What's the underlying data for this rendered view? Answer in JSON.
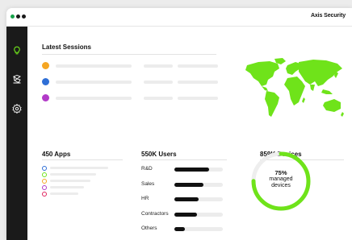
{
  "window": {
    "brand": "Axis Security",
    "traffic_light_colors": [
      "#16a34a",
      "#1a1a1a",
      "#1a1a1a"
    ]
  },
  "sidebar": {
    "items": [
      {
        "icon": "lightbulb-icon",
        "active": true
      },
      {
        "icon": "network-icon",
        "active": false
      },
      {
        "icon": "gear-icon",
        "active": false
      }
    ]
  },
  "sessions": {
    "title": "Latest Sessions",
    "rows": [
      {
        "color": "#f5a623"
      },
      {
        "color": "#2f6fd6"
      },
      {
        "color": "#b23bc8"
      }
    ]
  },
  "map": {
    "color": "#6fe31a",
    "icon": "world-map"
  },
  "apps": {
    "title": "450 Apps",
    "items": [
      {
        "color": "#2f6fd6",
        "bar_fraction": 0.78
      },
      {
        "color": "#6fe31a",
        "bar_fraction": 0.62
      },
      {
        "color": "#f5a623",
        "bar_fraction": 0.54
      },
      {
        "color": "#b23bc8",
        "bar_fraction": 0.46
      },
      {
        "color": "#e0245e",
        "bar_fraction": 0.38
      }
    ]
  },
  "users": {
    "title": "550K Users",
    "rows": [
      {
        "label": "R&D",
        "value": 0.72
      },
      {
        "label": "Sales",
        "value": 0.6
      },
      {
        "label": "HR",
        "value": 0.5
      },
      {
        "label": "Contractors",
        "value": 0.46
      },
      {
        "label": "Others",
        "value": 0.22
      }
    ]
  },
  "devices": {
    "title": "859K Devices",
    "percent": 75,
    "percent_label": "75%",
    "caption_line1": "managed",
    "caption_line2": "devices",
    "color": "#6fe31a"
  },
  "colors": {
    "accent": "#6fe31a",
    "sidebar": "#1a1a1a"
  }
}
